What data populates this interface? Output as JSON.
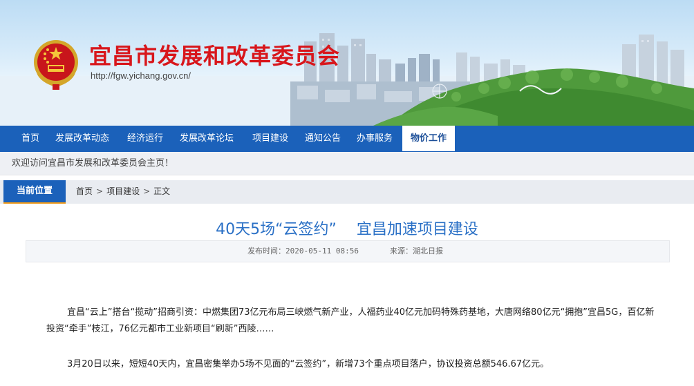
{
  "header": {
    "site_title": "宜昌市发展和改革委员会",
    "site_url": "http://fgw.yichang.gov.cn/"
  },
  "nav": {
    "items": [
      {
        "label": "首页"
      },
      {
        "label": "发展改革动态"
      },
      {
        "label": "经济运行"
      },
      {
        "label": "发展改革论坛"
      },
      {
        "label": "项目建设"
      },
      {
        "label": "通知公告"
      },
      {
        "label": "办事服务"
      },
      {
        "label": "物价工作"
      }
    ],
    "active": "物价工作"
  },
  "welcome": "欢迎访问宜昌市发展和改革委员会主页！",
  "breadcrumb": {
    "label": "当前位置",
    "items": [
      "首页",
      "项目建设",
      "正文"
    ],
    "separator": ">"
  },
  "article": {
    "title": "40天5场“云签约”　 宜昌加速项目建设",
    "publish_time": "发布时间：2020-05-11 08:56",
    "source": "来源：湖北日报",
    "paragraphs": [
      "宜昌“云上”搭台“揽动”招商引资：中燃集团73亿元布局三峡燃气新产业，人福药业40亿元加码特殊药基地，大唐网络80亿元“拥抱”宜昌5G，百亿新投资“牵手”枝江，76亿元都市工业新项目“刷新”西陵……",
      "3月20日以来，短短40天内，宜昌密集举办5场不见面的“云签约”，新增73个重点项目落户，协议投资总额546.67亿元。"
    ]
  },
  "colors": {
    "title_red": "#d8161b",
    "nav_blue": "#1b61ba",
    "article_title_blue": "#2a70c6",
    "crumb_accent": "#f09a1a"
  },
  "icons": [
    "national-emblem"
  ]
}
